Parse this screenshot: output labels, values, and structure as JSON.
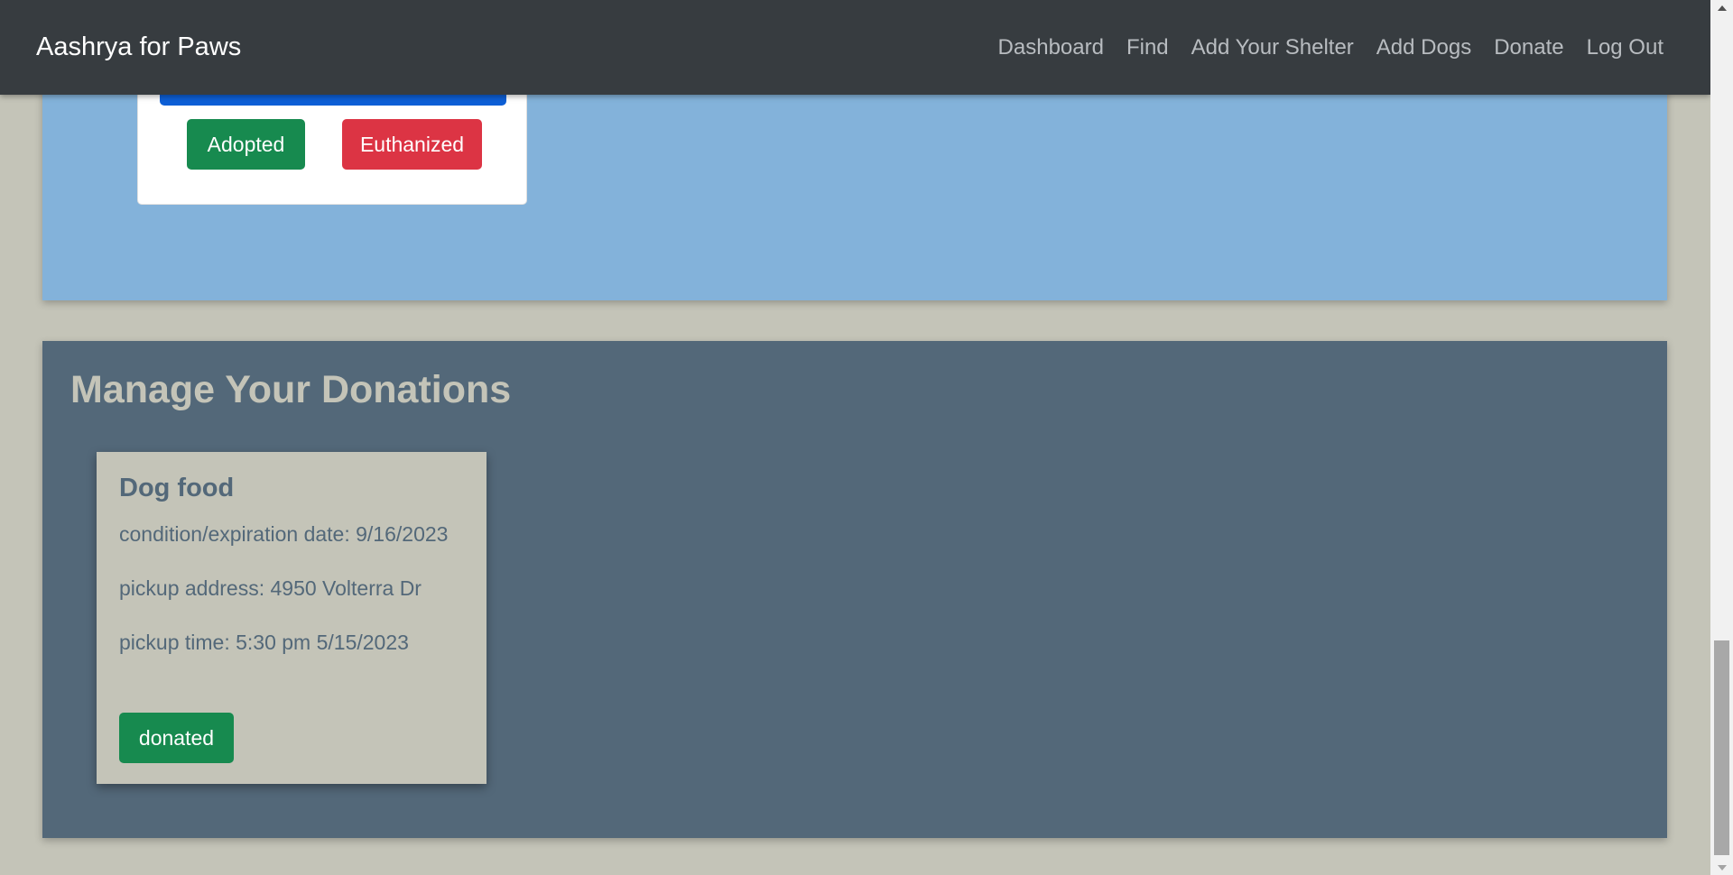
{
  "navbar": {
    "brand": "Aashrya for Paws",
    "links": [
      "Dashboard",
      "Find",
      "Add Your Shelter",
      "Add Dogs",
      "Donate",
      "Log Out"
    ]
  },
  "dog_card": {
    "adopted_label": "Adopted",
    "euthanized_label": "Euthanized"
  },
  "donations": {
    "title": "Manage Your Donations",
    "card": {
      "name": "Dog food",
      "condition": "condition/expiration date: 9/16/2023",
      "address": "pickup address: 4950 Volterra Dr",
      "time": "pickup time: 5:30 pm 5/15/2023",
      "status_label": "donated"
    }
  },
  "colors": {
    "navbar_bg": "#373c40",
    "dog_section_bg": "#83b2da",
    "donations_section_bg": "#536879",
    "page_bg": "#c4c4b8",
    "success": "#178a4f",
    "danger": "#dc3444",
    "primary": "#0d5fd6"
  },
  "icons": [
    "scroll-up-arrow-icon",
    "scroll-down-arrow-icon"
  ]
}
